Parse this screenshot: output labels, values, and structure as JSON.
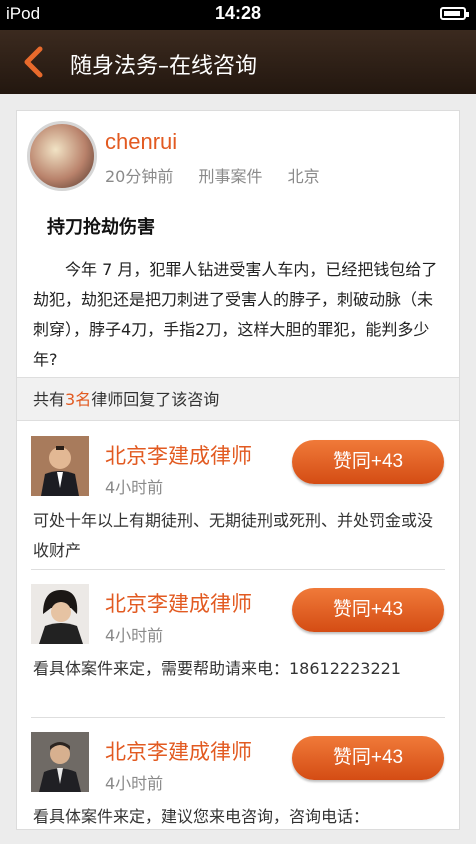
{
  "status_bar": {
    "carrier": "iPod",
    "time": "14:28"
  },
  "nav": {
    "title": "随身法务–在线咨询"
  },
  "question": {
    "username": "chenrui",
    "time": "20分钟前",
    "category": "刑事案件",
    "location": "北京",
    "title": "持刀抢劫伤害",
    "body": "今年 7 月，犯罪人钻进受害人车内，已经把钱包给了劫犯，劫犯还是把刀刺进了受害人的脖子，刺破动脉（未刺穿），脖子4刀，手指2刀，这样大胆的罪犯，能判多少年?"
  },
  "replies_header": {
    "prefix": "共有",
    "count": "3名",
    "suffix": "律师回复了该咨询"
  },
  "replies": [
    {
      "name": "北京李建成律师",
      "time": "4小时前",
      "agree": "赞同+43",
      "text": "可处十年以上有期徒刑、无期徒刑或死刑、并处罚金或没收财产"
    },
    {
      "name": "北京李建成律师",
      "time": "4小时前",
      "agree": "赞同+43",
      "text": "看具体案件来定，需要帮助请来电：18612223221"
    },
    {
      "name": "北京李建成律师",
      "time": "4小时前",
      "agree": "赞同+43",
      "text": "看具体案件来定，建议您来电咨询，咨询电话："
    }
  ],
  "colors": {
    "accent": "#e25a21",
    "navbar": "#2e2018"
  }
}
